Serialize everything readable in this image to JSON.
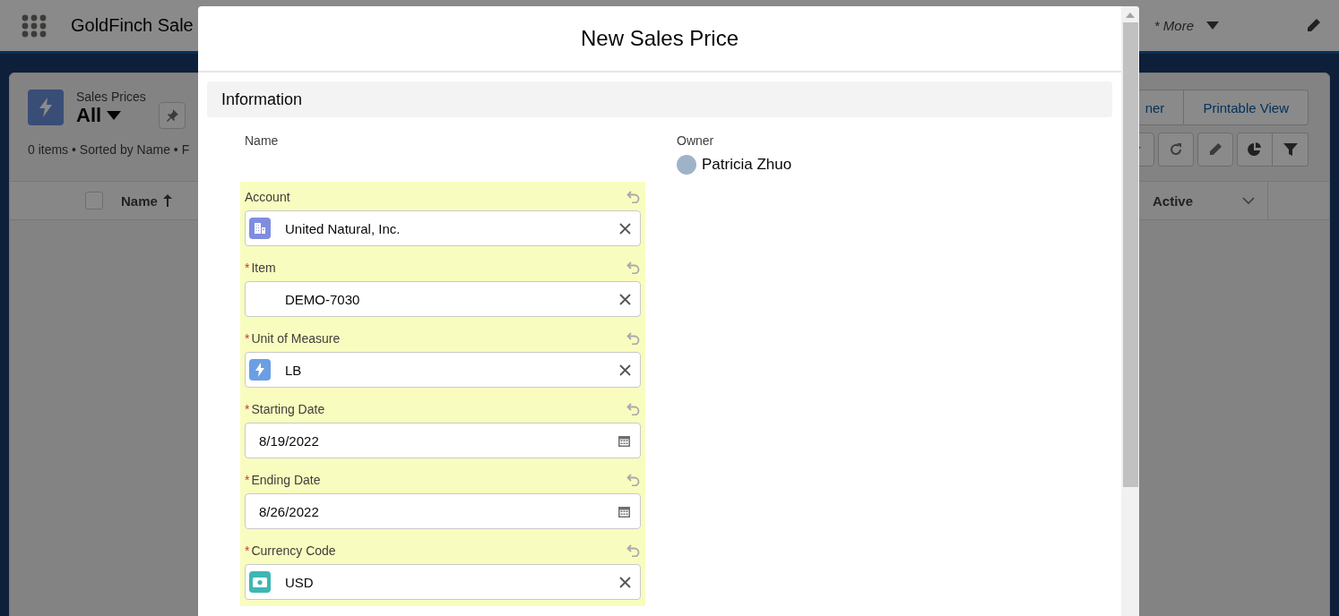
{
  "app": {
    "title": "GoldFinch Sale",
    "more_tab": "* More"
  },
  "list_view": {
    "object": "Sales Prices",
    "view": "All",
    "summary": "0 items • Sorted by Name • F",
    "buttons": [
      "ner",
      "Printable View"
    ],
    "select_all_checked": false,
    "columns": [
      {
        "label": "Name",
        "sorted": true
      },
      {
        "label": "Active",
        "sorted": false
      }
    ]
  },
  "modal": {
    "title": "New Sales Price",
    "section": "Information",
    "name_label": "Name",
    "owner_label": "Owner",
    "owner": "Patricia Zhuo",
    "fields": [
      {
        "label": "Account",
        "kind": "account",
        "changed": true,
        "value": "United Natural, Inc."
      },
      {
        "label": "Item",
        "kind": "item",
        "required_mark": "*",
        "changed": true,
        "value": "DEMO-7030"
      },
      {
        "label": "Unit of Measure",
        "kind": "unit",
        "required_mark": "*",
        "changed": true,
        "value": "LB"
      },
      {
        "label": "Starting Date",
        "kind": "date",
        "required_mark": "*",
        "changed": true,
        "value": "8/19/2022"
      },
      {
        "label": "Ending Date",
        "kind": "date",
        "required_mark": "*",
        "changed": true,
        "value": "8/26/2022"
      },
      {
        "label": "Currency Code",
        "kind": "currency",
        "required_mark": "*",
        "changed": true,
        "value": "USD"
      }
    ]
  }
}
